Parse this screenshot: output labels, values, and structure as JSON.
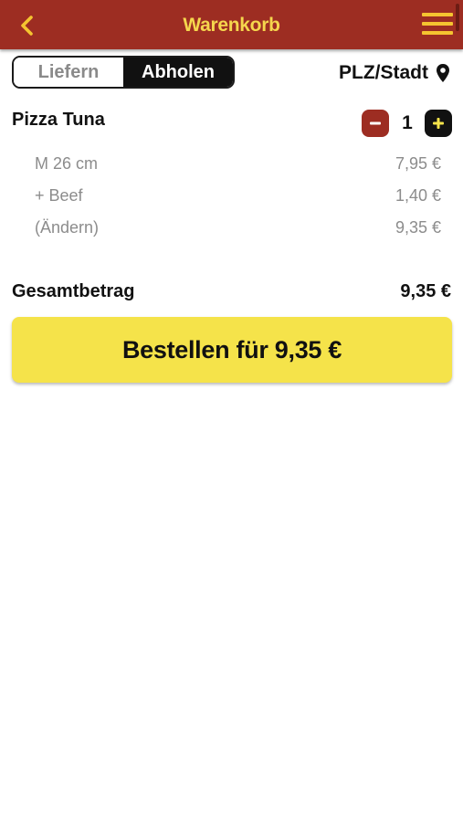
{
  "header": {
    "title": "Warenkorb",
    "back_icon": "chevron-left-icon",
    "menu_icon": "hamburger-menu-icon"
  },
  "mode_toggle": {
    "options": [
      "Liefern",
      "Abholen"
    ],
    "selected": "Abholen"
  },
  "location": {
    "label": "PLZ/Stadt",
    "icon": "map-pin-icon"
  },
  "cart": {
    "items": [
      {
        "name": "Pizza Tuna",
        "quantity": "1",
        "details": [
          {
            "label": "M 26 cm",
            "price": "7,95 €"
          },
          {
            "label": "+ Beef",
            "price": "1,40 €"
          },
          {
            "label": "(Ändern)",
            "price": "9,35 €"
          }
        ]
      }
    ]
  },
  "summary": {
    "total_label": "Gesamtbetrag",
    "total_value": "9,35 €"
  },
  "order_button": {
    "label": "Bestellen für 9,35 €"
  },
  "colors": {
    "header_bg": "#9d2d22",
    "header_text": "#f5d64d",
    "accent_yellow": "#f5e34a",
    "minus_button": "#9d2d22",
    "plus_button": "#111111"
  }
}
